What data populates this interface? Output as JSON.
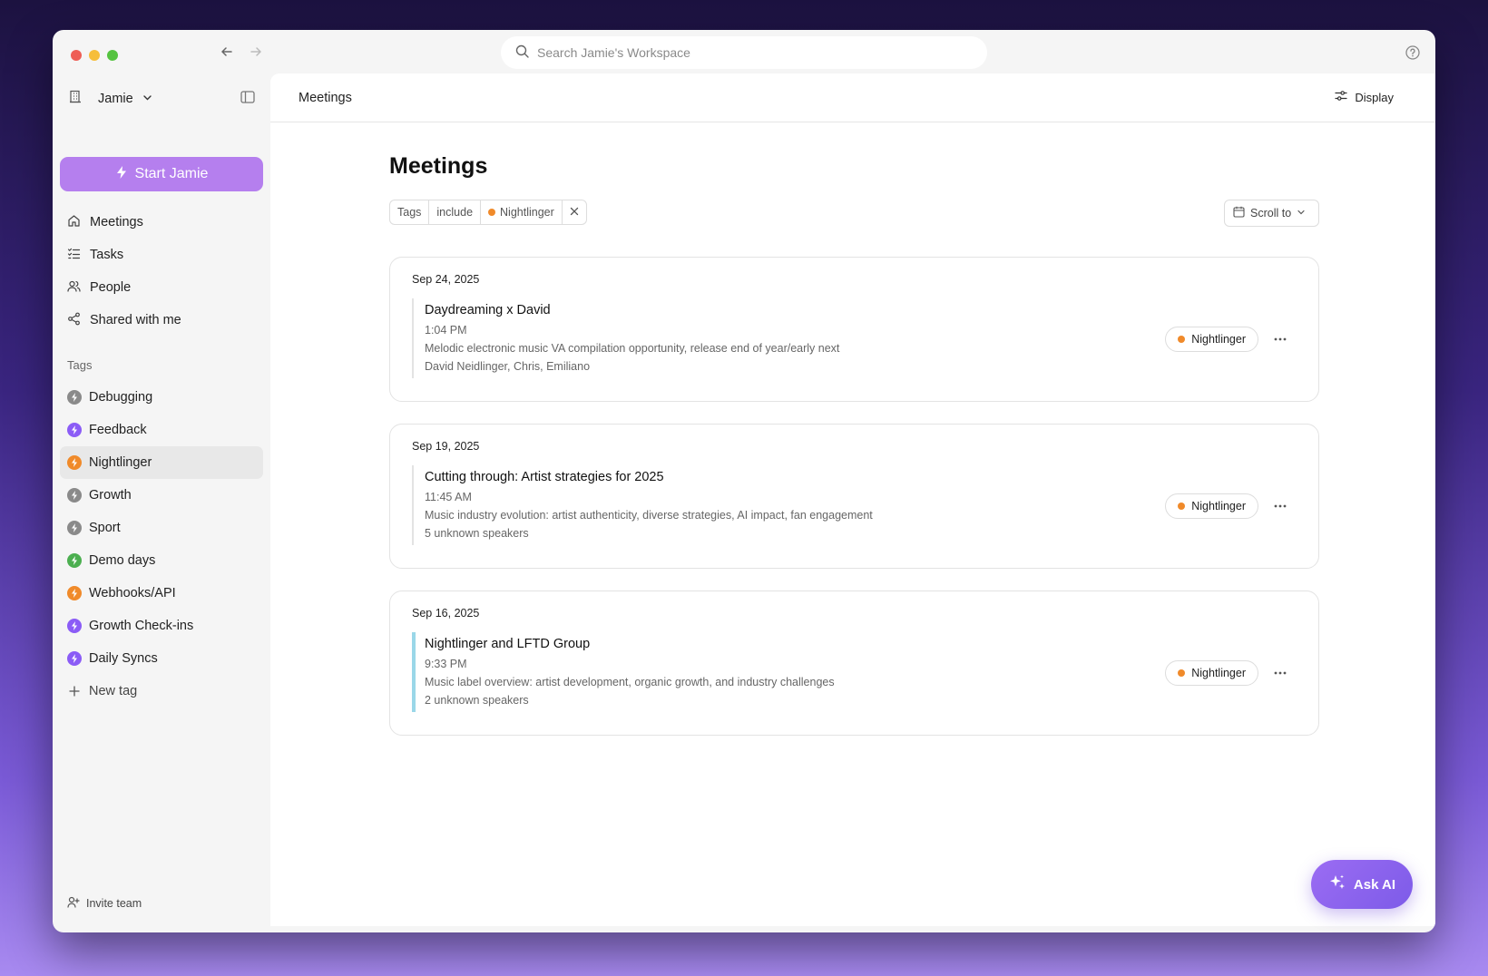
{
  "search": {
    "placeholder": "Search Jamie's Workspace"
  },
  "sidebar": {
    "workspace_name": "Jamie",
    "start_button": "Start Jamie",
    "nav": [
      {
        "label": "Meetings",
        "icon": "home-icon"
      },
      {
        "label": "Tasks",
        "icon": "tasks-icon"
      },
      {
        "label": "People",
        "icon": "people-icon"
      },
      {
        "label": "Shared with me",
        "icon": "share-icon"
      }
    ],
    "tags_heading": "Tags",
    "tags": [
      {
        "label": "Debugging",
        "color": "#8a8a8a"
      },
      {
        "label": "Feedback",
        "color": "#8b5cf6"
      },
      {
        "label": "Nightlinger",
        "color": "#f08a2a"
      },
      {
        "label": "Growth",
        "color": "#8a8a8a"
      },
      {
        "label": "Sport",
        "color": "#8a8a8a"
      },
      {
        "label": "Demo days",
        "color": "#4caf50"
      },
      {
        "label": "Webhooks/API",
        "color": "#f08a2a"
      },
      {
        "label": "Growth Check-ins",
        "color": "#8b5cf6"
      },
      {
        "label": "Daily Syncs",
        "color": "#8b5cf6"
      }
    ],
    "new_tag": "New tag",
    "invite": "Invite team"
  },
  "main": {
    "header_title": "Meetings",
    "display_label": "Display",
    "page_title": "Meetings",
    "filter": {
      "field": "Tags",
      "operator": "include",
      "value": "Nightlinger"
    },
    "scroll_to": "Scroll to",
    "meetings": [
      {
        "date": "Sep 24, 2025",
        "title": "Daydreaming x David",
        "time": "1:04 PM",
        "summary": "Melodic electronic music VA compilation opportunity, release end of year/early next",
        "participants": "David Neidlinger, Chris, Emiliano",
        "tag": "Nightlinger"
      },
      {
        "date": "Sep 19, 2025",
        "title": "Cutting through: Artist strategies for 2025",
        "time": "11:45 AM",
        "summary": "Music industry evolution: artist authenticity, diverse strategies, AI impact, fan engagement",
        "participants": "5 unknown speakers",
        "tag": "Nightlinger"
      },
      {
        "date": "Sep 16, 2025",
        "title": "Nightlinger and LFTD Group",
        "time": "9:33 PM",
        "summary": "Music label overview: artist development, organic growth, and industry challenges",
        "participants": "2 unknown speakers",
        "tag": "Nightlinger"
      }
    ],
    "ask_ai": "Ask AI"
  },
  "colors": {
    "accent": "#b57fee",
    "tag_orange": "#f08a2a",
    "ask_ai": "#8b63ee"
  }
}
